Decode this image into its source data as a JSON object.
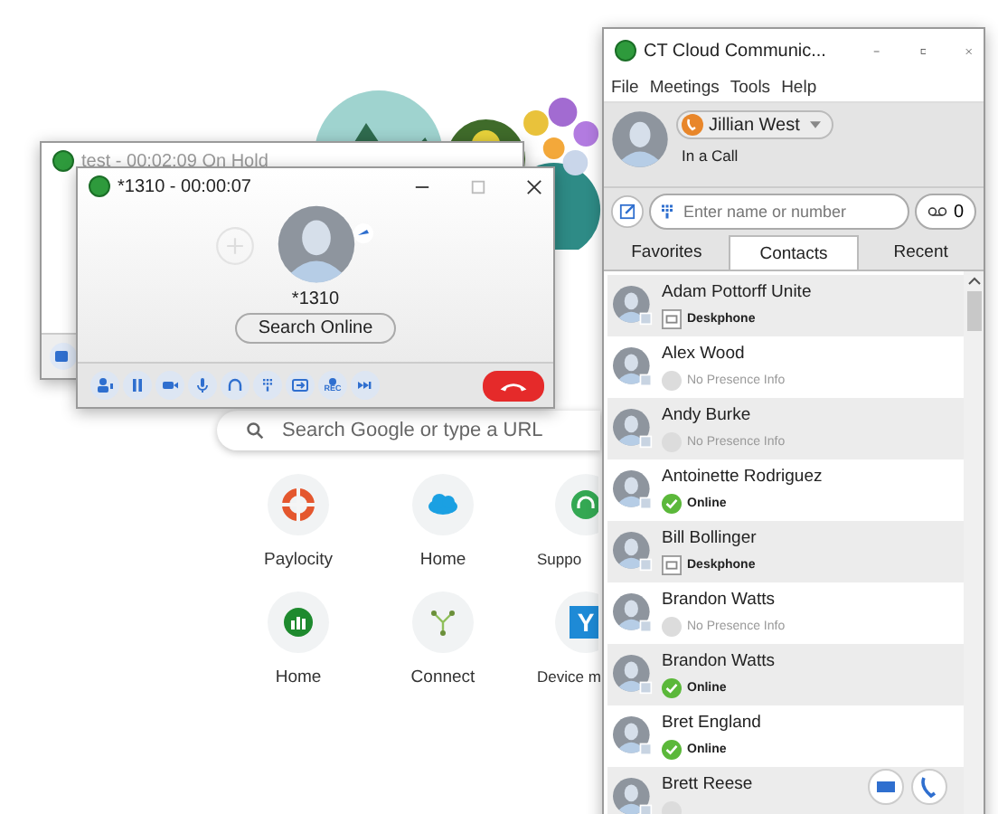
{
  "browser": {
    "search": {
      "placeholder": "Search Google or type a URL"
    },
    "shortcuts": [
      {
        "label": "Paylocity",
        "kind": "ring"
      },
      {
        "label": "Home",
        "kind": "cloud"
      },
      {
        "label": "Suppo",
        "kind": "headset"
      },
      {
        "label": "Home",
        "kind": "chart"
      },
      {
        "label": "Connect",
        "kind": "nodes"
      },
      {
        "label": "Device m",
        "kind": "letter",
        "glyph": "Y"
      }
    ]
  },
  "hold_window": {
    "title": "test - 00:02:09 On Hold"
  },
  "call_window": {
    "title": "*1310 - 00:00:07",
    "caller": "*1310",
    "search_button": "Search Online",
    "rec_label": "REC"
  },
  "contacts_window": {
    "title": "CT Cloud Communic...",
    "menu": [
      "File",
      "Meetings",
      "Tools",
      "Help"
    ],
    "user": {
      "name": "Jillian West",
      "status": "In a Call"
    },
    "search": {
      "placeholder": "Enter name or number"
    },
    "voicemail_count": "0",
    "tabs": [
      {
        "label": "Favorites",
        "selected": false
      },
      {
        "label": "Contacts",
        "selected": true
      },
      {
        "label": "Recent",
        "selected": false
      }
    ],
    "contacts": [
      {
        "name": "Adam Pottorff Unite",
        "kind": "deskphone",
        "status": "Deskphone"
      },
      {
        "name": "Alex Wood",
        "kind": "none",
        "status": "No Presence Info"
      },
      {
        "name": "Andy Burke",
        "kind": "none",
        "status": "No Presence Info"
      },
      {
        "name": "Antoinette Rodriguez",
        "kind": "online",
        "status": "Online"
      },
      {
        "name": "Bill Bollinger",
        "kind": "deskphone",
        "status": "Deskphone"
      },
      {
        "name": "Brandon Watts",
        "kind": "none",
        "status": "No Presence Info"
      },
      {
        "name": "Brandon Watts",
        "kind": "online",
        "status": "Online"
      },
      {
        "name": "Bret England",
        "kind": "online",
        "status": "Online"
      },
      {
        "name": "Brett Reese",
        "kind": "none"
      }
    ]
  }
}
